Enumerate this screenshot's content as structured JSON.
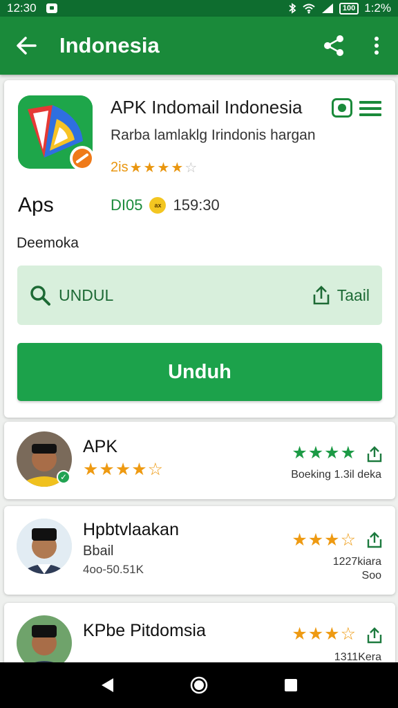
{
  "status_bar": {
    "time": "12:30",
    "battery": "100",
    "battery_pct": "1:2%"
  },
  "app_bar": {
    "title": "Indonesia"
  },
  "app": {
    "name": "APK Indomail Indonesia",
    "subtitle": "Rarba lamlaklg Irindonis hargan",
    "rating_text": "2is",
    "rating_stars": 3.5,
    "apps_label": "Aps",
    "code": "DI05",
    "coin": "ax",
    "time": "159:30",
    "description": "Deemoka"
  },
  "search": {
    "text": "UNDUL",
    "share_label": "Taail"
  },
  "download": {
    "label": "Unduh"
  },
  "list": [
    {
      "title": "APK",
      "stars_left": "★★★★☆",
      "stars_right": "★★★★",
      "meta1": "Boeking 1.3il deka",
      "meta2": ""
    },
    {
      "title": "Hpbtvlaakan",
      "sub": "Bbail",
      "sub2": "4oo-50.51K",
      "stars_right": "★★★☆",
      "meta1": "1227kiara",
      "meta2": "Soo"
    },
    {
      "title": "KPbe Pitdomsia",
      "stars_right": "★★★☆",
      "meta1": "1311Kera",
      "meta2": ""
    }
  ],
  "colors": {
    "primary": "#1a8a3a",
    "status": "#0e6d2f",
    "accent": "#1ca24b",
    "star": "#ee9a12"
  }
}
